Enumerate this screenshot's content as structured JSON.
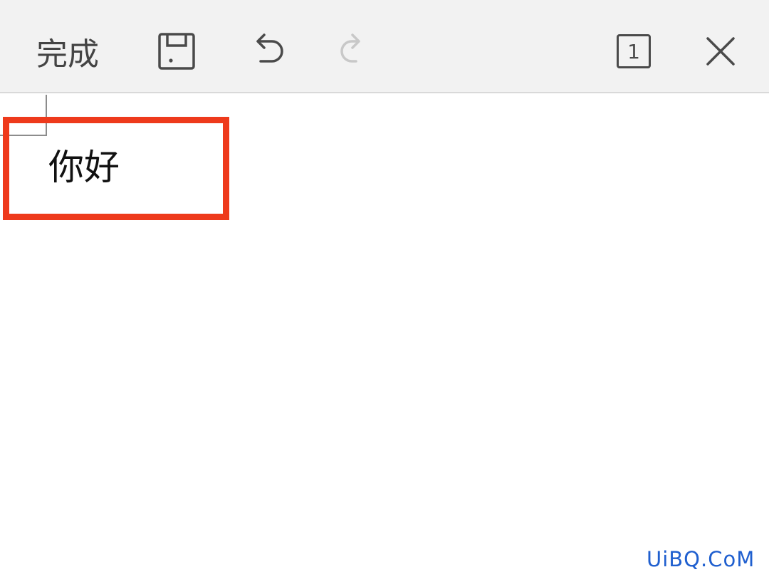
{
  "toolbar": {
    "done_label": "完成",
    "page_count": "1",
    "icons": {
      "save": "save-icon",
      "undo": "undo-icon",
      "redo": "redo-icon",
      "page": "page-count-icon",
      "close": "close-icon"
    },
    "redo_enabled": false
  },
  "document": {
    "text": "你好"
  },
  "highlight_color": "#ee3a1c",
  "watermark": "UiBQ.CoM"
}
